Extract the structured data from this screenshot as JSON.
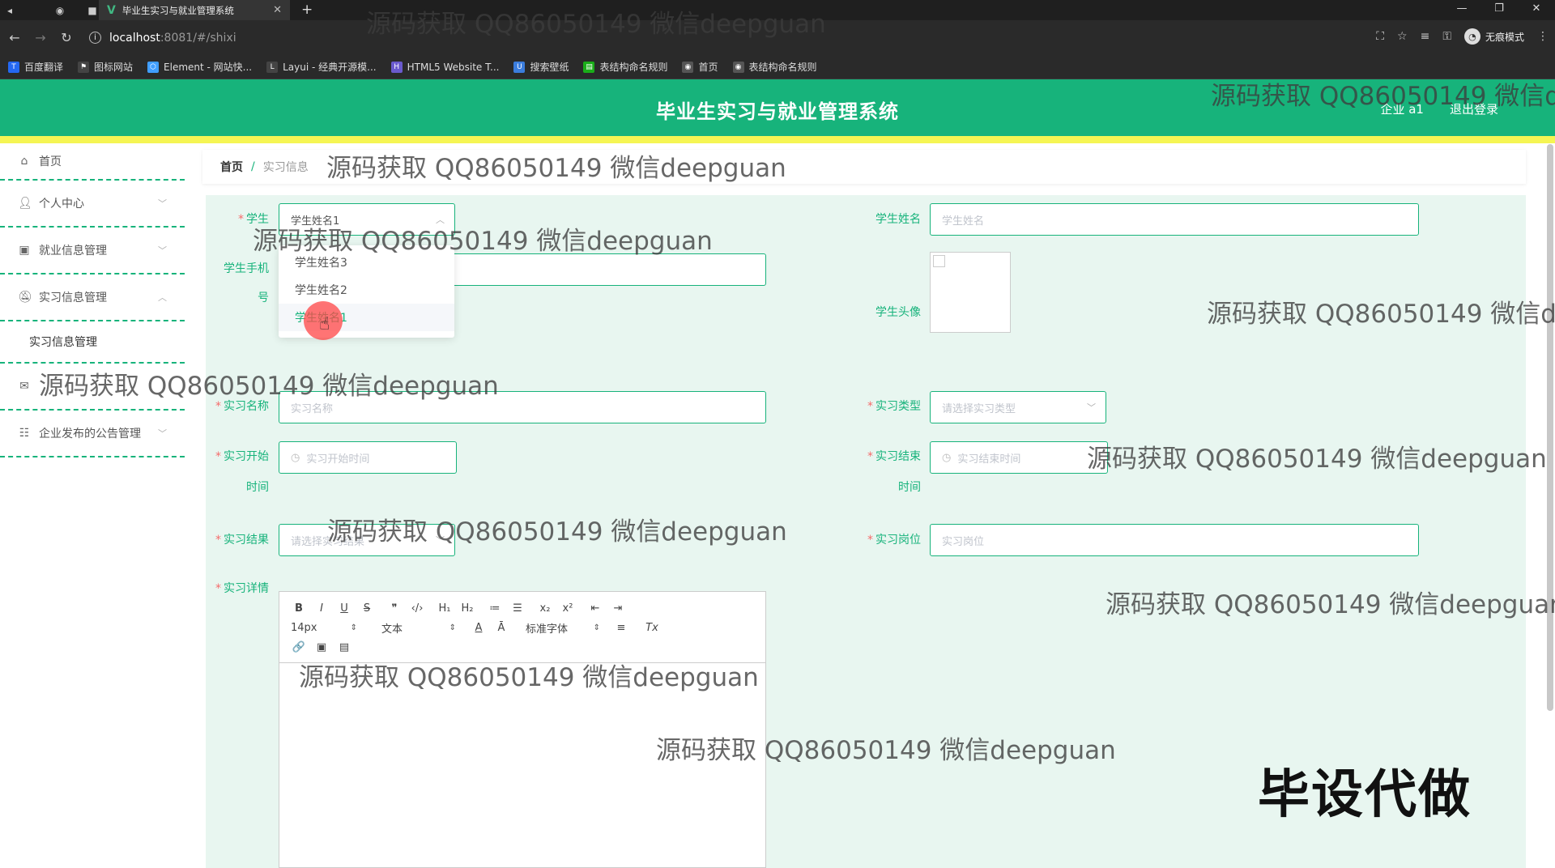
{
  "browser": {
    "tab_title": "毕业生实习与就业管理系统",
    "url_host": "localhost",
    "url_path": ":8081/#/shixi",
    "incognito_label": "无痕模式",
    "bookmarks": [
      {
        "label": "百度翻译",
        "color": "#2468f2"
      },
      {
        "label": "图标网站",
        "color": "#444444"
      },
      {
        "label": "Element - 网站快...",
        "color": "#409eff"
      },
      {
        "label": "Layui - 经典开源模...",
        "color": "#444444"
      },
      {
        "label": "HTML5 Website T...",
        "color": "#6a5acd"
      },
      {
        "label": "搜索壁纸",
        "color": "#3b7ddd"
      },
      {
        "label": "表结构命名规则",
        "color": "#1aad19"
      },
      {
        "label": "首页",
        "color": "#555555"
      },
      {
        "label": "表结构命名规则",
        "color": "#555555"
      }
    ]
  },
  "header": {
    "title": "毕业生实习与就业管理系统",
    "user": "企业 a1",
    "logout": "退出登录",
    "color": "#17b37b"
  },
  "sidebar": {
    "items": [
      {
        "label": "首页",
        "icon": "home-icon"
      },
      {
        "label": "个人中心",
        "icon": "user-icon"
      },
      {
        "label": "就业信息管理",
        "icon": "clipboard-icon"
      },
      {
        "label": "实习信息管理",
        "icon": "bell-icon"
      },
      {
        "label": "",
        "icon": "mail-icon"
      },
      {
        "label": "企业发布的公告管理",
        "icon": "sliders-icon"
      }
    ],
    "sub_item": "实习信息管理"
  },
  "breadcrumb": {
    "home": "首页",
    "separator": "/",
    "current": "实习信息"
  },
  "form": {
    "student_label": "学生",
    "student_value": "学生姓名1",
    "student_name_label": "学生姓名",
    "student_name_placeholder": "学生姓名",
    "phone_label_1": "学生手机",
    "phone_label_2": "号",
    "avatar_label": "学生头像",
    "intern_name_label": "实习名称",
    "intern_name_placeholder": "实习名称",
    "intern_type_label": "实习类型",
    "intern_type_placeholder": "请选择实习类型",
    "start_label_1": "实习开始",
    "start_label_2": "时间",
    "start_placeholder": "实习开始时间",
    "end_label_1": "实习结束",
    "end_label_2": "时间",
    "end_placeholder": "实习结束时间",
    "result_label": "实习结果",
    "result_placeholder": "请选择实习结果",
    "position_label": "实习岗位",
    "position_placeholder": "实习岗位",
    "detail_label": "实习详情",
    "required_mark": "*"
  },
  "dropdown": {
    "options": [
      "学生姓名3",
      "学生姓名2",
      "学生姓名1"
    ],
    "selected_index": 2
  },
  "editor": {
    "row1": [
      "B",
      "I",
      "U",
      "S",
      "❞",
      "‹/›",
      "H₁",
      "H₂",
      "≔",
      "☰",
      "x₂",
      "x²",
      "⇤",
      "⇥"
    ],
    "font_size": "14px",
    "block": "文本",
    "font": "标准字体",
    "row2_buttons": [
      "A",
      "Ā",
      "≡",
      "Tx"
    ],
    "row3": [
      "🔗",
      "▣",
      "▤"
    ]
  },
  "watermark": {
    "text": "源码获取 QQ86050149 微信deepguan",
    "stamp": "毕设代做"
  }
}
